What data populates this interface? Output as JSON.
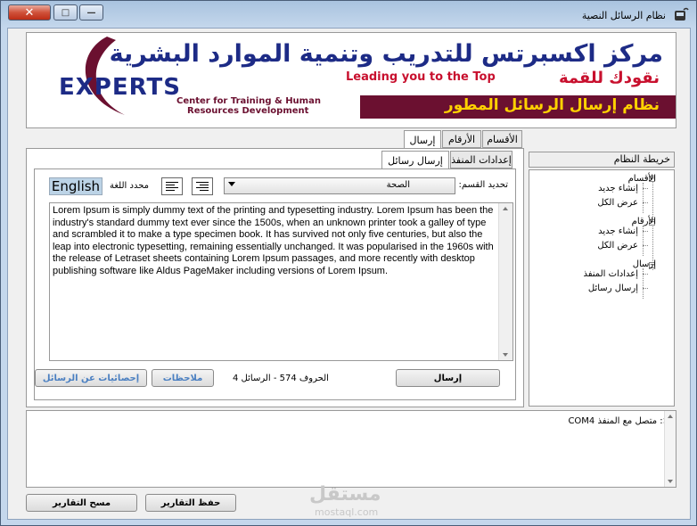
{
  "window": {
    "title": "نظام الرسائل النصية",
    "close_glyph": "✕",
    "max_glyph": "□",
    "min_glyph": "—"
  },
  "banner": {
    "arabic_title": "مركز اكسبرتس للتدريب وتنمية الموارد البشرية",
    "slogan_en": "Leading you to the Top",
    "slogan_ar": "نقودك للقمة",
    "system_name": "نظام إرسال الرسائل المطور",
    "brand": "EXPERTS",
    "brand_sub_1": "Center for Training & Human",
    "brand_sub_2": "Resources Development"
  },
  "main_tabs": [
    {
      "label": "إرسال",
      "active": true
    },
    {
      "label": "الأرقام",
      "active": false
    },
    {
      "label": "الأقسام",
      "active": false
    }
  ],
  "sub_tabs": [
    {
      "label": "إرسال رسائل",
      "active": true
    },
    {
      "label": "إعدادات المنفذ",
      "active": false
    }
  ],
  "compose": {
    "department_label": "تحديد القسم:",
    "department_value": "الصحة",
    "language_label": "محدد اللغة",
    "language_button": "English",
    "message": "Lorem Ipsum is simply dummy text of the printing and typesetting industry. Lorem Ipsum has been the industry's standard dummy text ever since the 1500s, when an unknown printer took a galley of type and scrambled it to make a type specimen book. It has survived not only five centuries, but also the leap into electronic typesetting, remaining essentially unchanged. It was popularised in the 1960s with the release of Letraset sheets containing Lorem Ipsum passages, and more recently with desktop publishing software like Aldus PageMaker including versions of Lorem Ipsum.",
    "send_button": "إرسال",
    "counter_text": "الحروف  574 - الرسائل  4",
    "notes_button": "ملاحظات",
    "stats_button": "إحصائيات عن الرسائل"
  },
  "tree": {
    "title": "خريطة النظام",
    "groups": [
      {
        "label": "الأقسام",
        "children": [
          "إنشاء جديد",
          "عرض الكل"
        ]
      },
      {
        "label": "الأرقام",
        "children": [
          "إنشاء جديد",
          "عرض الكل"
        ]
      },
      {
        "label": "إرسال",
        "children": [
          "إعدادات المنفذ",
          "إرسال رسائل"
        ]
      }
    ]
  },
  "log": {
    "text": "<: متصل مع المنفذ COM4"
  },
  "footer": {
    "save_reports": "حفظ التقارير",
    "clear_reports": "مسح التقارير"
  },
  "watermark": {
    "ar": "مستقل",
    "en": "mostaql.com"
  }
}
